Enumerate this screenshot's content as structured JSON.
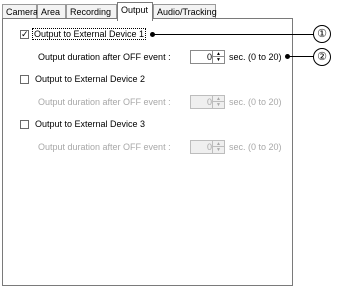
{
  "tabs": [
    {
      "label": "Camera"
    },
    {
      "label": "Area"
    },
    {
      "label": "Recording"
    },
    {
      "label": "Output"
    },
    {
      "label": "Audio/Tracking"
    }
  ],
  "devices": [
    {
      "label": "Output to External Device 1",
      "checked": true,
      "duration_label": "Output duration after OFF event :",
      "value": "0",
      "unit": "sec. (0 to 20)",
      "enabled": true
    },
    {
      "label": "Output to External Device 2",
      "checked": false,
      "duration_label": "Output duration after OFF event :",
      "value": "0",
      "unit": "sec. (0 to 20)",
      "enabled": false
    },
    {
      "label": "Output to External Device 3",
      "checked": false,
      "duration_label": "Output duration after OFF event :",
      "value": "0",
      "unit": "sec. (0 to 20)",
      "enabled": false
    }
  ],
  "callouts": [
    {
      "number": "①"
    },
    {
      "number": "②"
    }
  ]
}
